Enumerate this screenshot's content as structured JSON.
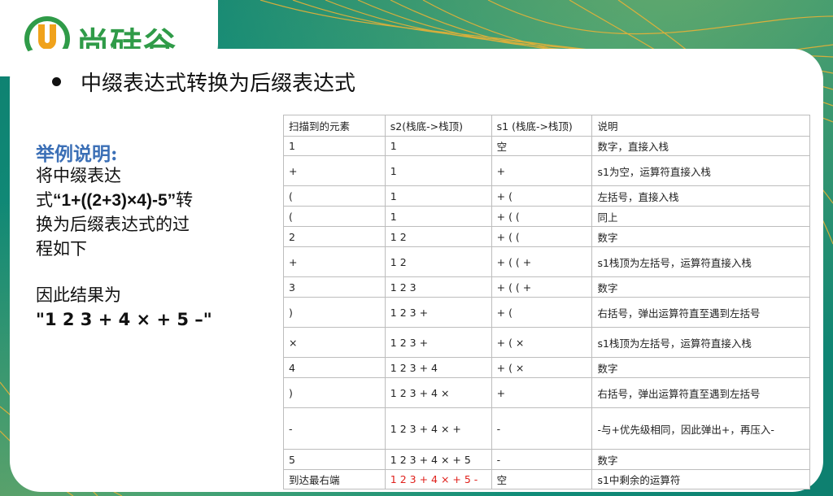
{
  "logo": {
    "text": "尚硅谷"
  },
  "heading": {
    "text": "中缀表达式转换为后缀表达式"
  },
  "example": {
    "title": "举例说明:",
    "line1": "将中缀表达",
    "line2_prefix": "式",
    "expr": "“1+((2+3)×4)-5”",
    "line2_suffix": "转",
    "line3": "换为后缀表达式的过",
    "line4": "程如下"
  },
  "result": {
    "label": "因此结果为",
    "value": "\"1 2 3 + 4 × + 5 –\""
  },
  "table": {
    "headers": [
      "扫描到的元素",
      "s2(栈底->栈顶)",
      "s1 (栈底->栈顶)",
      "说明"
    ],
    "rows": [
      {
        "c": [
          "1",
          "1",
          "空",
          "数字，直接入栈"
        ],
        "h": 24
      },
      {
        "c": [
          "+",
          "1",
          "+",
          "s1为空，运算符直接入栈"
        ],
        "h": 37
      },
      {
        "c": [
          "(",
          "1",
          "+ (",
          "左括号，直接入栈"
        ],
        "h": 25
      },
      {
        "c": [
          "(",
          "1",
          "+ ( (",
          "同上"
        ],
        "h": 25
      },
      {
        "c": [
          "2",
          "1 2",
          "+ ( (",
          "数字"
        ],
        "h": 25
      },
      {
        "c": [
          "+",
          "1 2",
          "+ ( ( +",
          "s1栈顶为左括号，运算符直接入栈"
        ],
        "h": 37
      },
      {
        "c": [
          "3",
          "1 2 3",
          "+ ( ( +",
          "数字"
        ],
        "h": 25
      },
      {
        "c": [
          ")",
          "1 2 3 +",
          "+ (",
          "右括号，弹出运算符直至遇到左括号"
        ],
        "h": 37
      },
      {
        "c": [
          "×",
          "1 2 3 +",
          "+ ( ×",
          "s1栈顶为左括号，运算符直接入栈"
        ],
        "h": 37
      },
      {
        "c": [
          "4",
          "1 2 3 + 4",
          "+ ( ×",
          "数字"
        ],
        "h": 25
      },
      {
        "c": [
          ")",
          "1 2 3 + 4 ×",
          "+",
          "右括号，弹出运算符直至遇到左括号"
        ],
        "h": 37
      },
      {
        "c": [
          "-",
          "1 2 3 + 4 × +",
          "-",
          "-与+优先级相同，因此弹出+，再压入-"
        ],
        "h": 51
      },
      {
        "c": [
          "5",
          "1 2 3 + 4 × + 5",
          "-",
          "数字"
        ],
        "h": 25
      },
      {
        "c": [
          "到达最右端",
          "1 2 3 + 4 × + 5 -",
          "空",
          "s1中剩余的运算符"
        ],
        "h": 24,
        "red": 1
      }
    ]
  }
}
